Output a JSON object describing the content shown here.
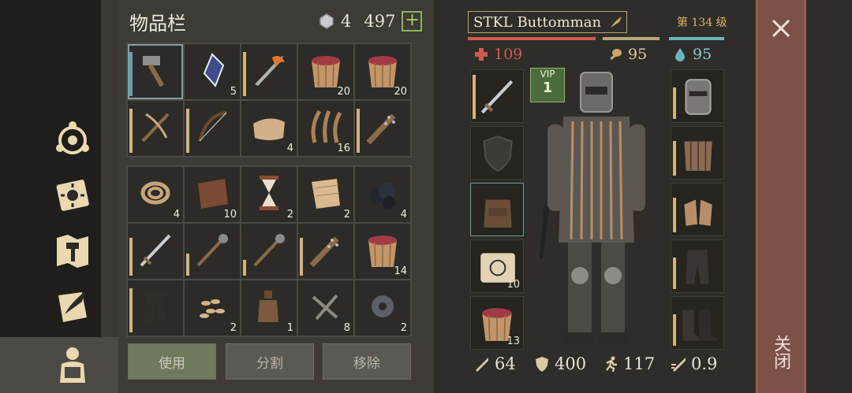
{
  "inventory": {
    "title": "物品栏",
    "gems": "4",
    "coins": "497",
    "add_label": "+",
    "grid_top": [
      {
        "icon": "hammer-icon",
        "count": ""
      },
      {
        "icon": "crystal-icon",
        "count": "5"
      },
      {
        "icon": "flaming-sword-icon",
        "count": ""
      },
      {
        "icon": "berry-bucket-icon",
        "count": "20"
      },
      {
        "icon": "berry-bucket-icon",
        "count": "20"
      },
      {
        "icon": "crossbow-icon",
        "count": ""
      },
      {
        "icon": "bow-icon",
        "count": ""
      },
      {
        "icon": "cloth-icon",
        "count": "4"
      },
      {
        "icon": "fiber-icon",
        "count": "16"
      },
      {
        "icon": "spiked-club-icon",
        "count": ""
      }
    ],
    "grid_bottom": [
      {
        "icon": "rope-icon",
        "count": "4"
      },
      {
        "icon": "leather-icon",
        "count": "10"
      },
      {
        "icon": "hourglass-icon",
        "count": "2"
      },
      {
        "icon": "linen-icon",
        "count": "2"
      },
      {
        "icon": "coal-icon",
        "count": "4"
      },
      {
        "icon": "sword-icon",
        "count": ""
      },
      {
        "icon": "mace-icon",
        "count": ""
      },
      {
        "icon": "mace-icon",
        "count": ""
      },
      {
        "icon": "spiked-club-icon",
        "count": ""
      },
      {
        "icon": "berry-bucket-icon",
        "count": "14"
      },
      {
        "icon": "pants-icon",
        "count": ""
      },
      {
        "icon": "seeds-icon",
        "count": "2"
      },
      {
        "icon": "bottle-icon",
        "count": "1"
      },
      {
        "icon": "nails-icon",
        "count": "8"
      },
      {
        "icon": "gear-icon",
        "count": "2"
      }
    ],
    "actions": {
      "use": "使用",
      "split": "分割",
      "remove": "移除"
    }
  },
  "character": {
    "name": "STKL Buttomman",
    "level": "第 134 级",
    "health": "109",
    "food": "95",
    "water": "95",
    "vip_label": "VIP",
    "vip_level": "1",
    "left_slots": [
      {
        "icon": "sword-icon",
        "count": ""
      },
      {
        "icon": "shield-icon",
        "count": ""
      },
      {
        "icon": "backpack-icon",
        "count": ""
      },
      {
        "icon": "scroll-icon",
        "count": "10"
      },
      {
        "icon": "berry-bucket-icon",
        "count": "13"
      }
    ],
    "right_slots": [
      {
        "icon": "helmet-icon",
        "count": ""
      },
      {
        "icon": "chainmail-icon",
        "count": ""
      },
      {
        "icon": "gloves-icon",
        "count": ""
      },
      {
        "icon": "leggings-icon",
        "count": ""
      },
      {
        "icon": "boots-icon",
        "count": ""
      }
    ],
    "attack": "64",
    "armor": "400",
    "speed": "117",
    "attack_speed": "0.9"
  },
  "close_label": "关闭",
  "colors": {
    "health": "#cf5b4e",
    "food": "#b9a67c",
    "water": "#6ab4bf",
    "accent": "#d7b46a"
  }
}
